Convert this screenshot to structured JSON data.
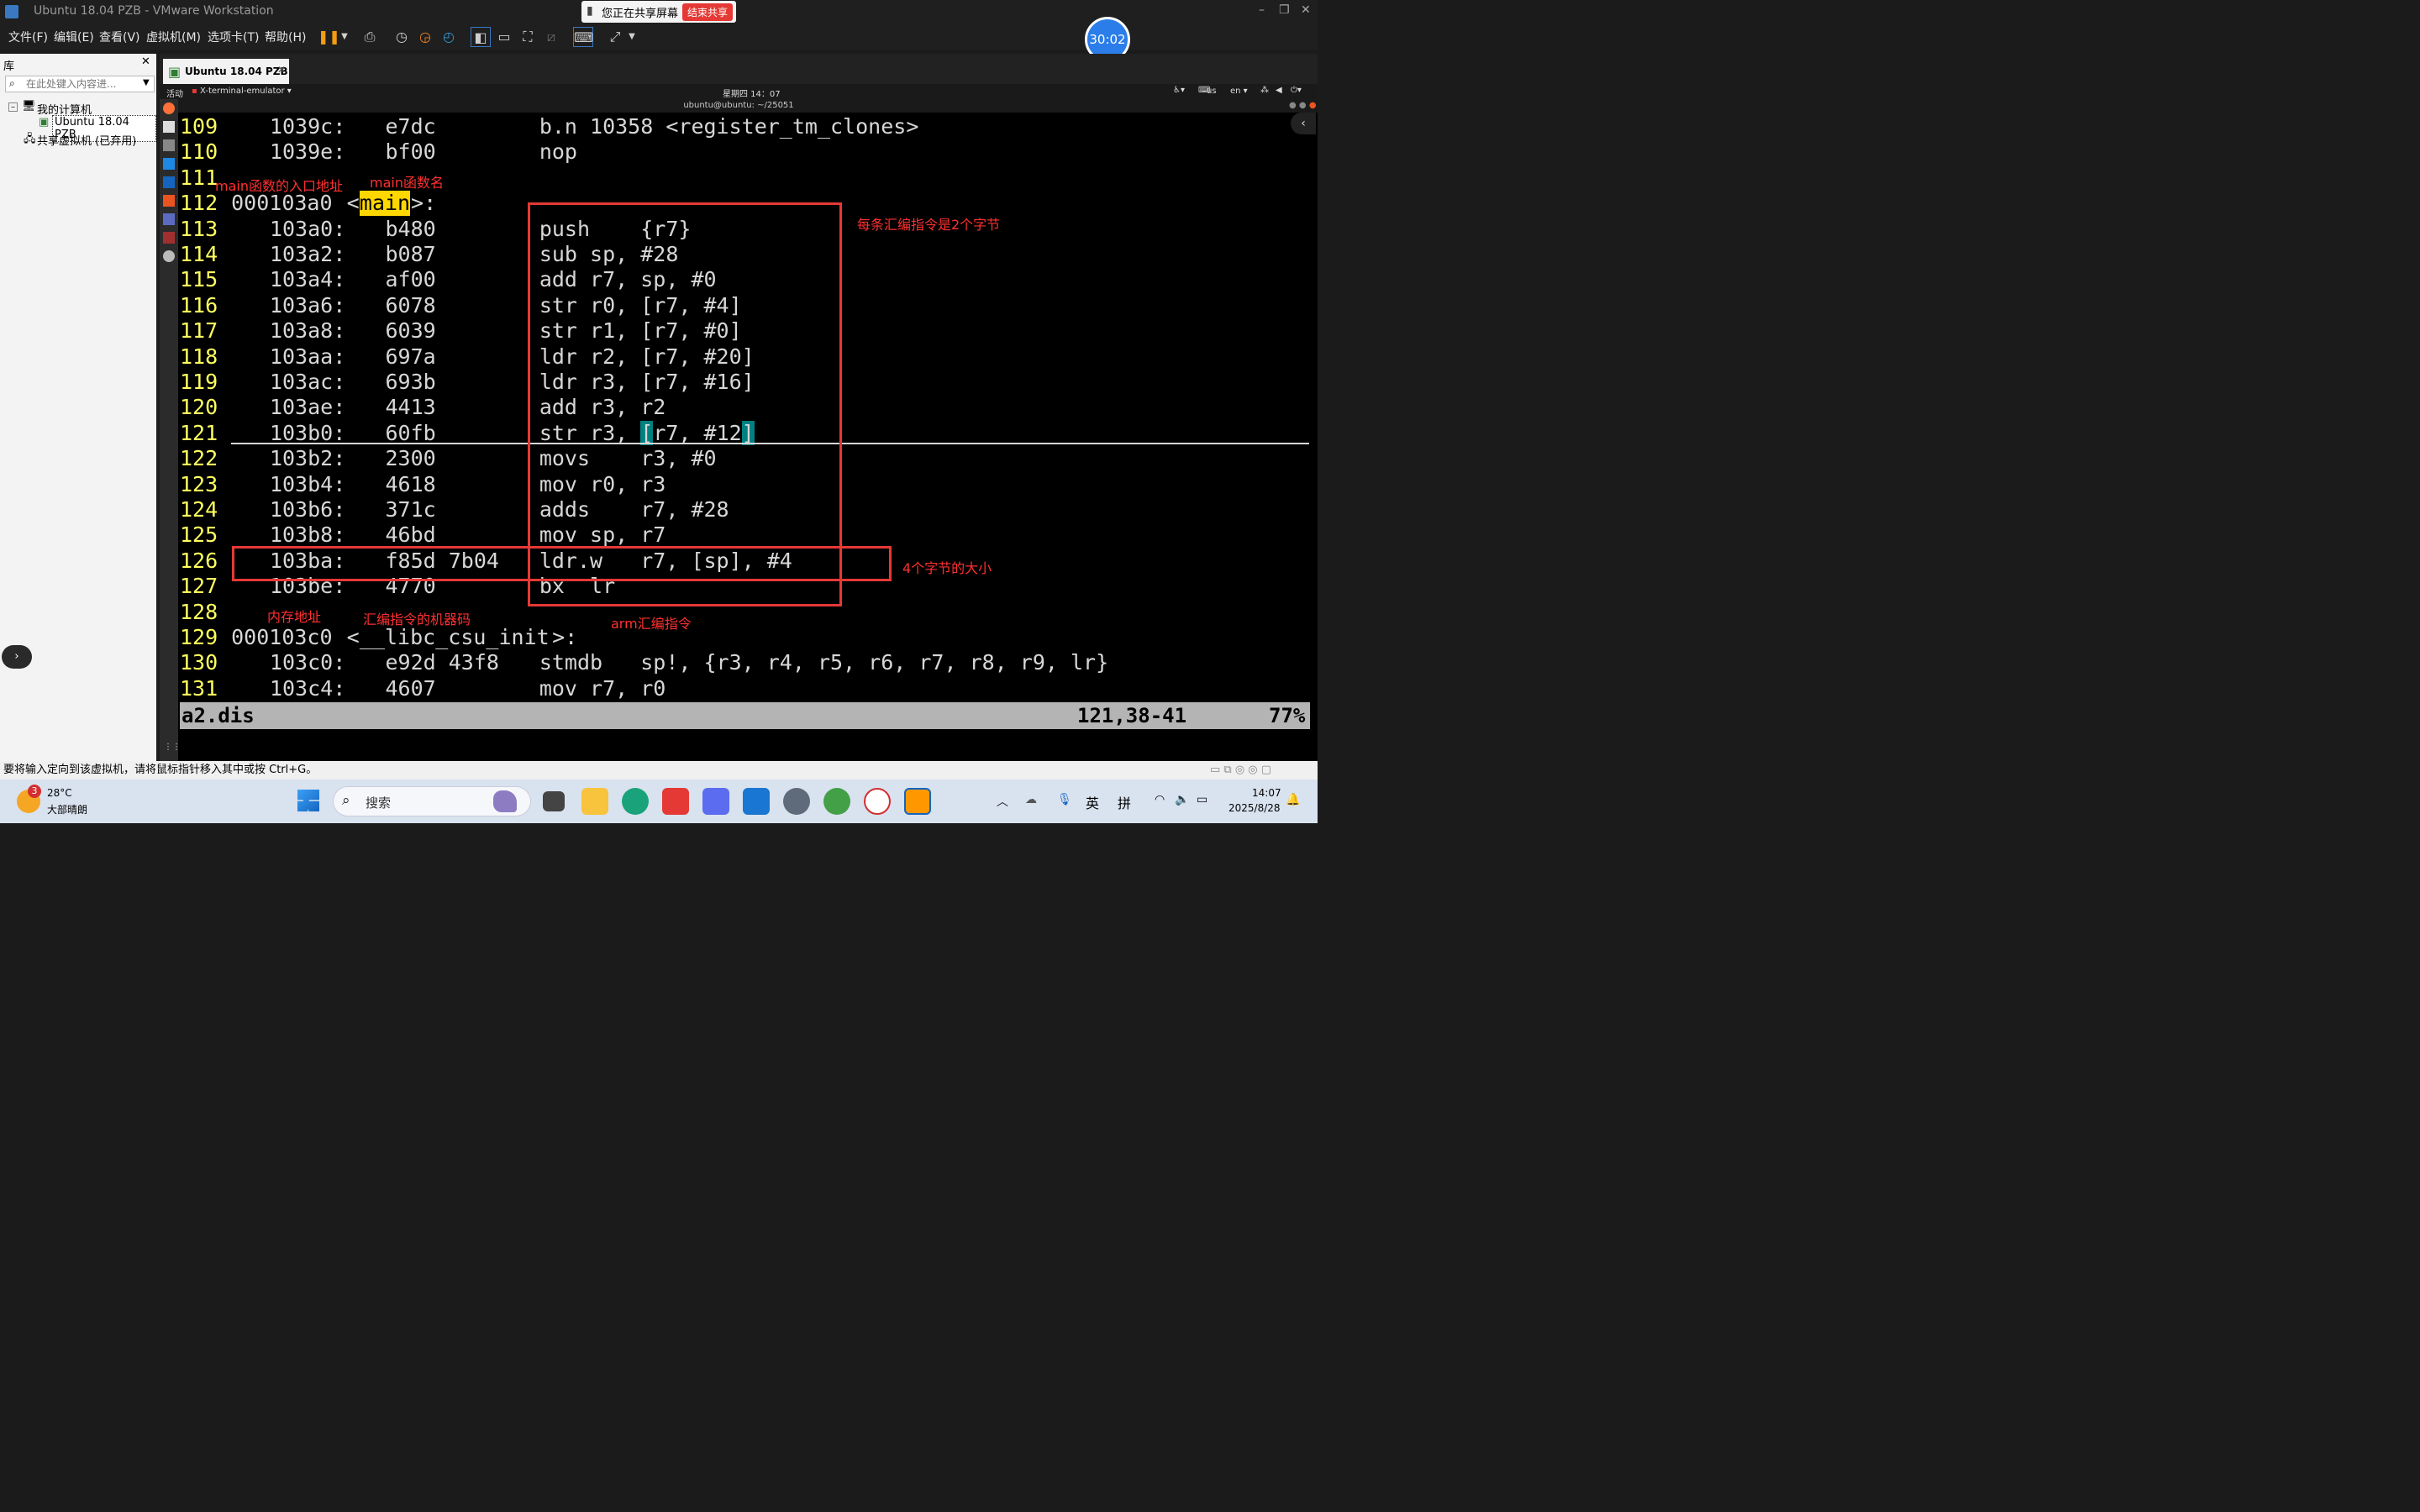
{
  "window": {
    "title": "Ubuntu 18.04 PZB - VMware Workstation",
    "share_text": "您正在共享屏幕",
    "stop_share": "结束共享",
    "timer": "30:02"
  },
  "menu": [
    "文件(F)",
    "编辑(E)",
    "查看(V)",
    "虚拟机(M)",
    "选项卡(T)",
    "帮助(H)"
  ],
  "sidebar": {
    "title": "库",
    "search_placeholder": "在此处键入内容进...",
    "tree_root": "我的计算机",
    "tree_vm": "Ubuntu 18.04 PZB",
    "tree_shared": "共享虚拟机 (已弃用)"
  },
  "vm_tab": "Ubuntu 18.04 PZB",
  "gnome": {
    "activities": "活动",
    "app": "X-terminal-emulator ▾",
    "clock": "星期四 14：07",
    "ime": "us",
    "lang": "en ▾"
  },
  "terminal_title": "ubuntu@ubuntu: ~/25051",
  "code_lines": [
    {
      "n": "109",
      "addr": "1039c:",
      "hex": "e7dc",
      "ins": "b.n 10358 <register_tm_clones>"
    },
    {
      "n": "110",
      "addr": "1039e:",
      "hex": "bf00",
      "ins": "nop"
    },
    {
      "n": "111",
      "addr": "",
      "hex": "",
      "ins": ""
    },
    {
      "n": "112",
      "label_addr": "000103a0",
      "label_pre": "<",
      "label_name": "main",
      "label_post": ">:"
    },
    {
      "n": "113",
      "addr": "103a0:",
      "hex": "b480",
      "ins": "push    {r7}"
    },
    {
      "n": "114",
      "addr": "103a2:",
      "hex": "b087",
      "ins": "sub sp, #28"
    },
    {
      "n": "115",
      "addr": "103a4:",
      "hex": "af00",
      "ins": "add r7, sp, #0"
    },
    {
      "n": "116",
      "addr": "103a6:",
      "hex": "6078",
      "ins": "str r0, [r7, #4]"
    },
    {
      "n": "117",
      "addr": "103a8:",
      "hex": "6039",
      "ins": "str r1, [r7, #0]"
    },
    {
      "n": "118",
      "addr": "103aa:",
      "hex": "697a",
      "ins": "ldr r2, [r7, #20]"
    },
    {
      "n": "119",
      "addr": "103ac:",
      "hex": "693b",
      "ins": "ldr r3, [r7, #16]"
    },
    {
      "n": "120",
      "addr": "103ae:",
      "hex": "4413",
      "ins": "add r3, r2"
    },
    {
      "n": "121",
      "addr": "103b0:",
      "hex": "60fb",
      "ins": "str r3, [r7, #12]"
    },
    {
      "n": "122",
      "addr": "103b2:",
      "hex": "2300",
      "ins": "movs    r3, #0"
    },
    {
      "n": "123",
      "addr": "103b4:",
      "hex": "4618",
      "ins": "mov r0, r3"
    },
    {
      "n": "124",
      "addr": "103b6:",
      "hex": "371c",
      "ins": "adds    r7, #28"
    },
    {
      "n": "125",
      "addr": "103b8:",
      "hex": "46bd",
      "ins": "mov sp, r7"
    },
    {
      "n": "126",
      "addr": "103ba:",
      "hex": "f85d 7b04",
      "ins": "ldr.w   r7, [sp], #4"
    },
    {
      "n": "127",
      "addr": "103be:",
      "hex": "4770",
      "ins": "bx  lr"
    },
    {
      "n": "128",
      "addr": "",
      "hex": "",
      "ins": ""
    },
    {
      "n": "129",
      "label_addr": "000103c0",
      "label_pre": "<",
      "label_name": "__libc_csu_init",
      "label_post": ">:"
    },
    {
      "n": "130",
      "addr": "103c0:",
      "hex": "e92d 43f8",
      "ins": "stmdb   sp!, {r3, r4, r5, r6, r7, r8, r9, lr}"
    },
    {
      "n": "131",
      "addr": "103c4:",
      "hex": "4607",
      "ins": "mov r7, r0"
    }
  ],
  "status": {
    "file": "a2.dis",
    "pos": "121,38-41",
    "pct": "77%"
  },
  "annotations": {
    "entry": "main函数的入口地址",
    "name": "main函数名",
    "bytes2": "每条汇编指令是2个字节",
    "bytes4": "4个字节的大小",
    "memaddr": "内存地址",
    "machine": "汇编指令的机器码",
    "arm": "arm汇编指令"
  },
  "hint": "要将输入定向到该虚拟机，请将鼠标指针移入其中或按 Ctrl+G。",
  "taskbar": {
    "weather_badge": "3",
    "temp": "28°C",
    "weather": "大部晴朗",
    "search": "搜索",
    "ime1": "英",
    "ime2": "拼",
    "time": "14:07",
    "date": "2025/8/28"
  },
  "colors": {
    "accent": "#e53935",
    "line_number": "#ffff5f",
    "highlight": "#ffd700",
    "status_bar": "#b4b4b4"
  }
}
